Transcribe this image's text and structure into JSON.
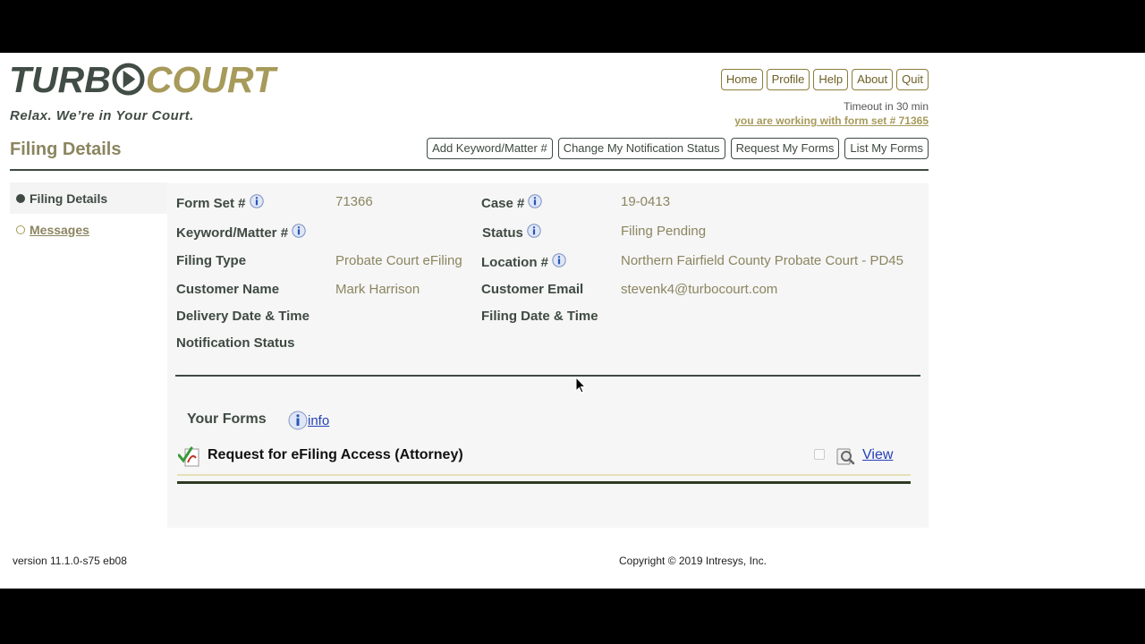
{
  "brand": {
    "logo_left": "TURB",
    "logo_right": "COURT",
    "tagline": "Relax.  We’re in Your Court."
  },
  "topnav": [
    {
      "label": "Home"
    },
    {
      "label": "Profile"
    },
    {
      "label": "Help"
    },
    {
      "label": "About"
    },
    {
      "label": "Quit"
    }
  ],
  "session": {
    "timeout": "Timeout in 30 min",
    "formset_link": "you are working with form set # 71365"
  },
  "section_title": "Filing Details",
  "actions": [
    {
      "label": "Add Keyword/Matter #"
    },
    {
      "label": "Change My Notification Status"
    },
    {
      "label": "Request My Forms"
    },
    {
      "label": "List My Forms"
    }
  ],
  "leftmenu": {
    "active": "Filing Details",
    "messages": "Messages"
  },
  "details": {
    "form_set_label": "Form Set #",
    "form_set_value": "71366",
    "case_label": "Case #",
    "case_value": "19-0413",
    "keyword_label": "Keyword/Matter #",
    "status_label": "Status",
    "status_value": "Filing Pending",
    "filing_type_label": "Filing Type",
    "filing_type_value": "Probate Court eFiling",
    "location_label": "Location #",
    "location_value": "Northern Fairfield County Probate Court - PD45",
    "customer_name_label": "Customer Name",
    "customer_name_value": "Mark Harrison",
    "customer_email_label": "Customer Email",
    "customer_email_value": "stevenk4@turbocourt.com",
    "delivery_label": "Delivery Date & Time",
    "filing_date_label": "Filing Date & Time",
    "notification_label": "Notification Status"
  },
  "your_forms": {
    "title": "Your Forms",
    "info_link": "info",
    "items": [
      {
        "name": "Request for eFiling Access (Attorney)",
        "view_label": "View"
      }
    ]
  },
  "footer": {
    "version": "version 11.1.0-s75   eb08",
    "copyright": "Copyright © 2019 Intresys, Inc."
  },
  "colors": {
    "brand_dark": "#414c45",
    "brand_gold": "#a79a5a",
    "link_blue": "#2440b8"
  }
}
